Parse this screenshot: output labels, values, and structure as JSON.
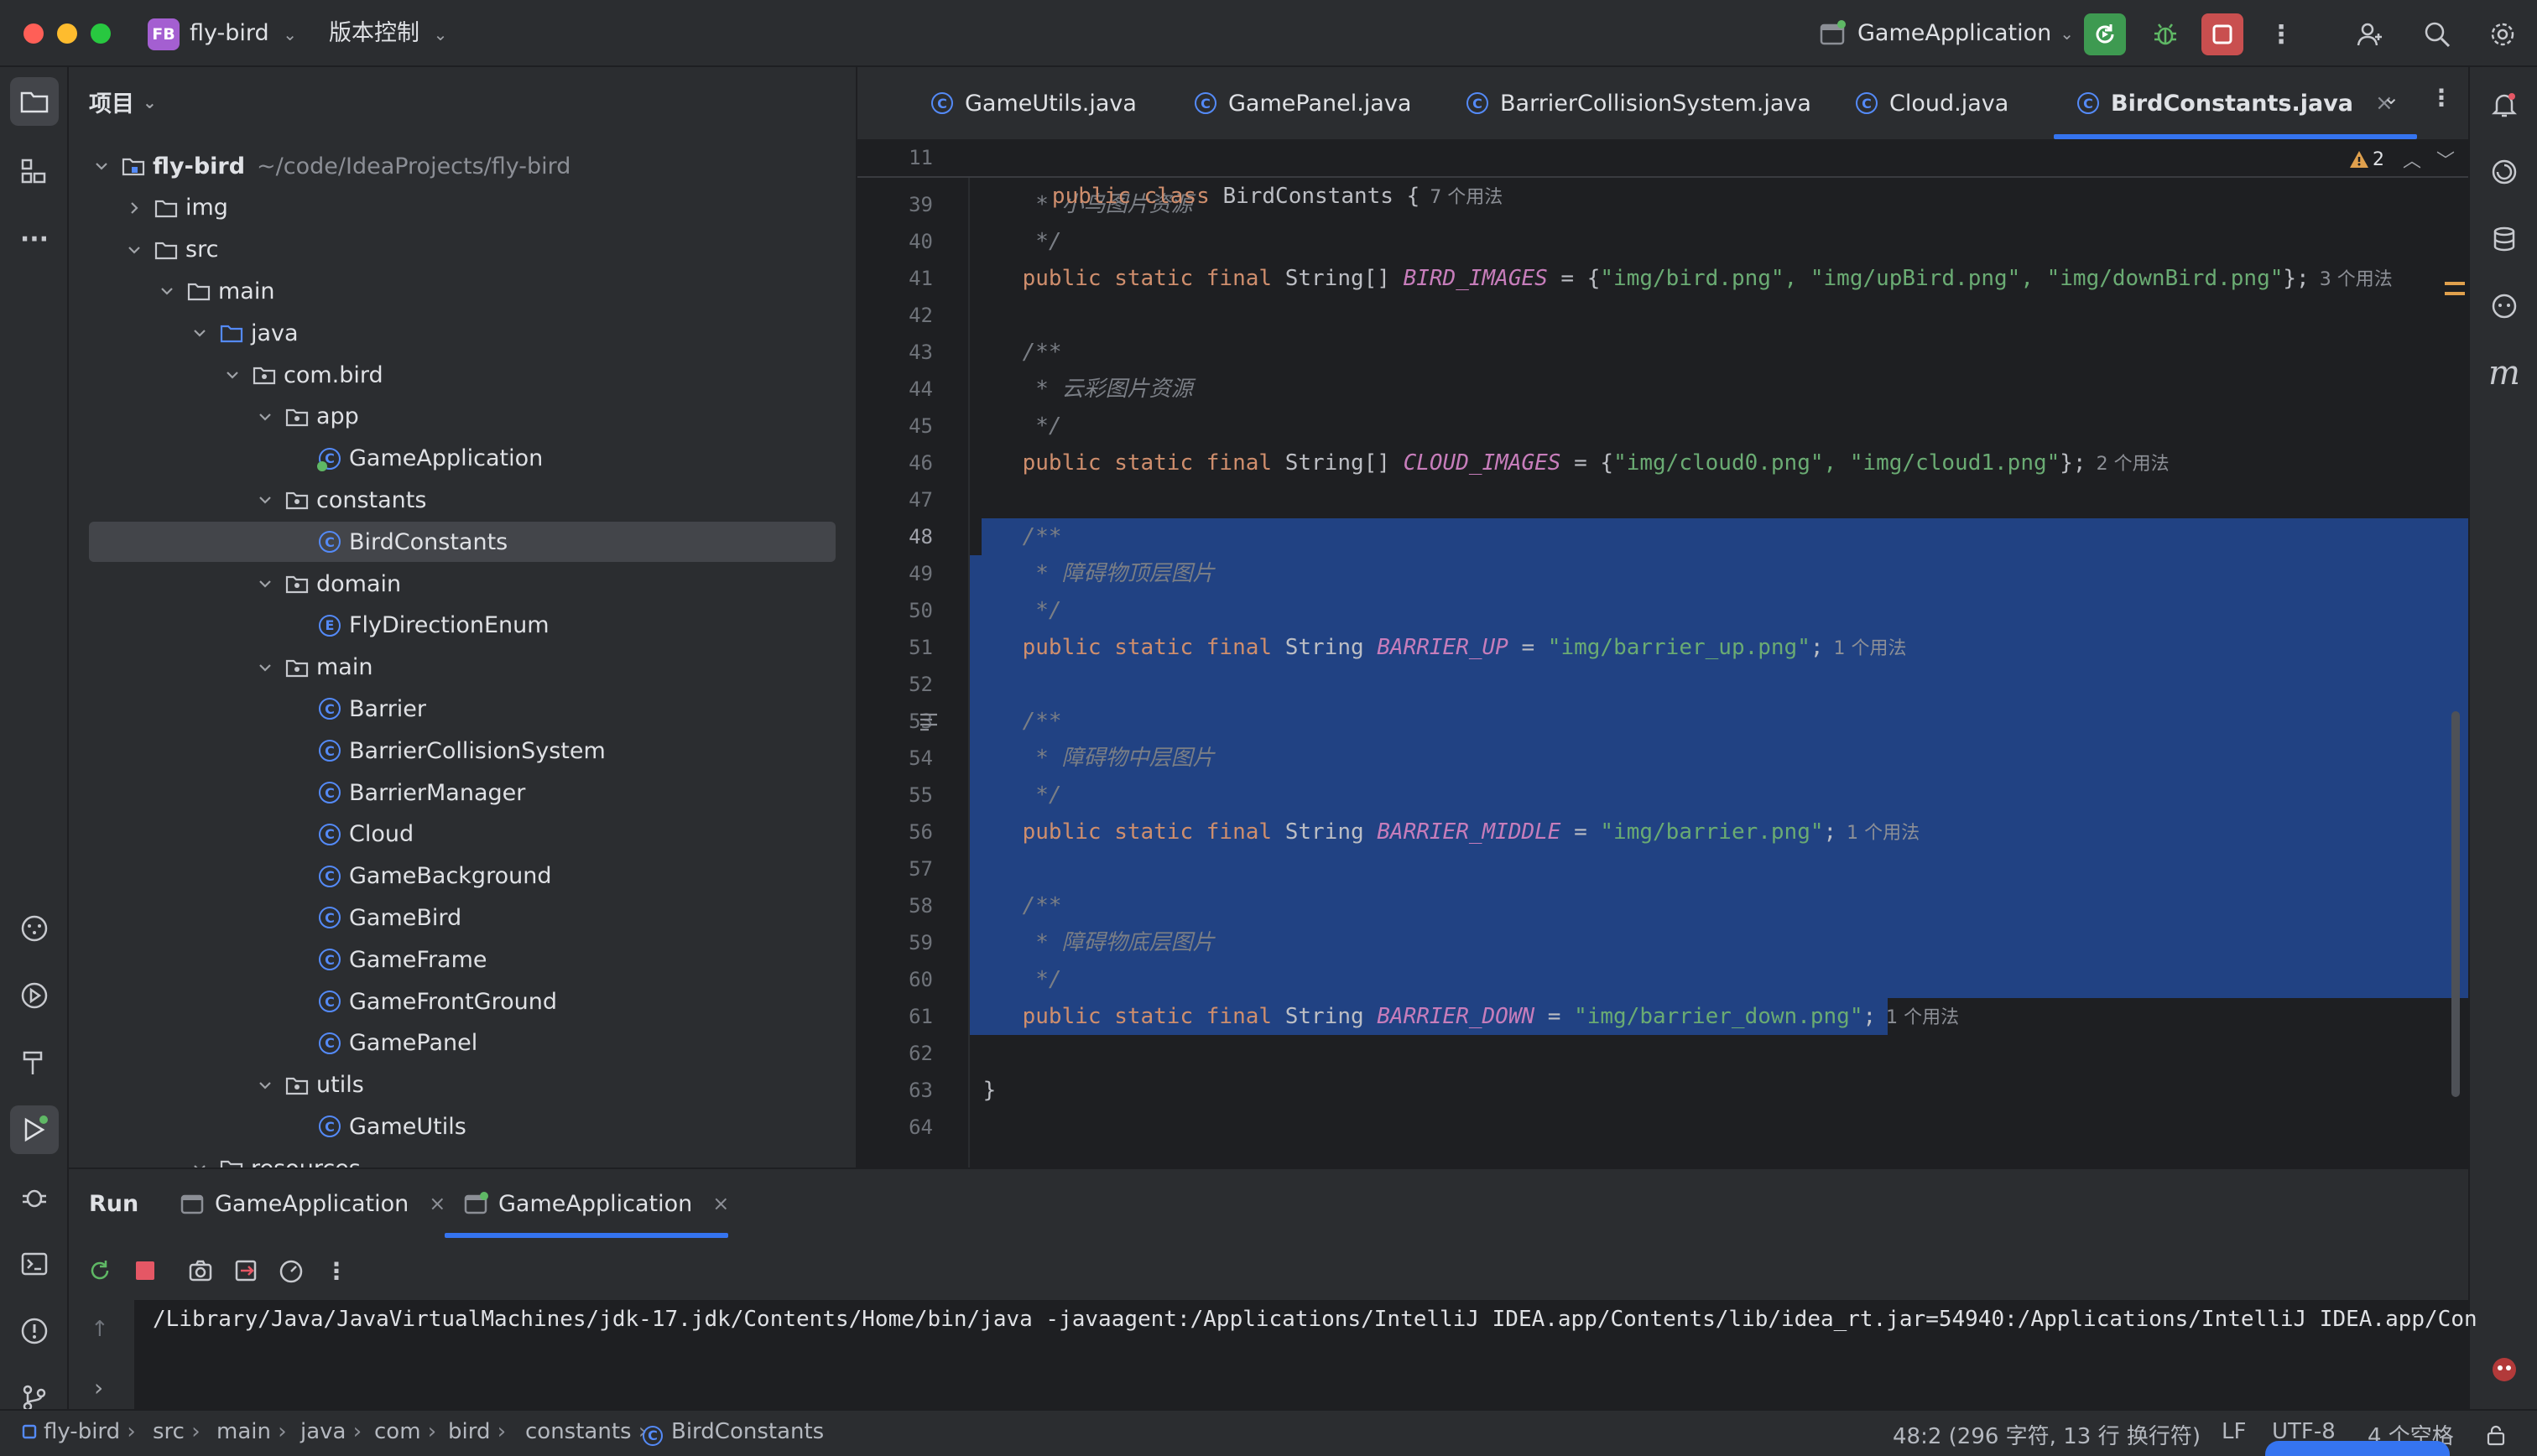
{
  "titlebar": {
    "project_badge": "FB",
    "project_name": "fly-bird",
    "vcs_label": "版本控制",
    "run_config": "GameApplication"
  },
  "project_panel": {
    "title": "项目",
    "tree": [
      {
        "label": "fly-bird",
        "path": "~/code/IdeaProjects/fly-bird"
      },
      {
        "label": "img"
      },
      {
        "label": "src"
      },
      {
        "label": "main"
      },
      {
        "label": "java"
      },
      {
        "label": "com.bird"
      },
      {
        "label": "app"
      },
      {
        "label": "GameApplication"
      },
      {
        "label": "constants"
      },
      {
        "label": "BirdConstants"
      },
      {
        "label": "domain"
      },
      {
        "label": "FlyDirectionEnum"
      },
      {
        "label": "main"
      },
      {
        "label": "Barrier"
      },
      {
        "label": "BarrierCollisionSystem"
      },
      {
        "label": "BarrierManager"
      },
      {
        "label": "Cloud"
      },
      {
        "label": "GameBackground"
      },
      {
        "label": "GameBird"
      },
      {
        "label": "GameFrame"
      },
      {
        "label": "GameFrontGround"
      },
      {
        "label": "GamePanel"
      },
      {
        "label": "utils"
      },
      {
        "label": "GameUtils"
      },
      {
        "label": "resources"
      }
    ]
  },
  "editor_tabs": [
    "GameUtils.java",
    "GamePanel.java",
    "BarrierCollisionSystem.java",
    "Cloud.java",
    "BirdConstants.java"
  ],
  "editor": {
    "sticky": {
      "line": "11",
      "kw1": "public",
      "kw2": "class",
      "name": "BirdConstants {",
      "hint": "7 个用法"
    },
    "warnings": "2",
    "lines": [
      {
        "n": "39",
        "c": " * 小鸟图片资源"
      },
      {
        "n": "40",
        "c": " */"
      },
      {
        "n": "41",
        "k": "public static final",
        "t": "String[]",
        "f": "BIRD_IMAGES",
        "eq": " = {",
        "s": "\"img/bird.png\", \"img/upBird.png\", \"img/downBird.png\"",
        "end": "};",
        "h": "3 个用法"
      },
      {
        "n": "42"
      },
      {
        "n": "43",
        "c": "/**"
      },
      {
        "n": "44",
        "c": " * 云彩图片资源"
      },
      {
        "n": "45",
        "c": " */"
      },
      {
        "n": "46",
        "k": "public static final",
        "t": "String[]",
        "f": "CLOUD_IMAGES",
        "eq": " = {",
        "s": "\"img/cloud0.png\", \"img/cloud1.png\"",
        "end": "};",
        "h": "2 个用法"
      },
      {
        "n": "47"
      },
      {
        "n": "48",
        "c": "/**"
      },
      {
        "n": "49",
        "c": " * 障碍物顶层图片"
      },
      {
        "n": "50",
        "c": " */"
      },
      {
        "n": "51",
        "k": "public static final",
        "t": "String",
        "f": "BARRIER_UP",
        "eq": " = ",
        "s": "\"img/barrier_up.png\"",
        "end": ";",
        "h": "1 个用法"
      },
      {
        "n": "52"
      },
      {
        "n": "53",
        "c": "/**"
      },
      {
        "n": "54",
        "c": " * 障碍物中层图片"
      },
      {
        "n": "55",
        "c": " */"
      },
      {
        "n": "56",
        "k": "public static final",
        "t": "String",
        "f": "BARRIER_MIDDLE",
        "eq": " = ",
        "s": "\"img/barrier.png\"",
        "end": ";",
        "h": "1 个用法"
      },
      {
        "n": "57"
      },
      {
        "n": "58",
        "c": "/**"
      },
      {
        "n": "59",
        "c": " * 障碍物底层图片"
      },
      {
        "n": "60",
        "c": " */"
      },
      {
        "n": "61",
        "k": "public static final",
        "t": "String",
        "f": "BARRIER_DOWN",
        "eq": " = ",
        "s": "\"img/barrier_down.png\"",
        "end": ";",
        "h": "1 个用法"
      },
      {
        "n": "62"
      },
      {
        "n": "63",
        "x": "}"
      },
      {
        "n": "64"
      }
    ]
  },
  "run_panel": {
    "title": "Run",
    "tabs": [
      "GameApplication",
      "GameApplication"
    ],
    "console_line": "/Library/Java/JavaVirtualMachines/jdk-17.jdk/Contents/Home/bin/java -javaagent:/Applications/IntelliJ IDEA.app/Contents/lib/idea_rt.jar=54940:/Applications/IntelliJ IDEA.app/Con"
  },
  "statusbar": {
    "breadcrumb": [
      "fly-bird",
      "src",
      "main",
      "java",
      "com",
      "bird",
      "constants",
      "BirdConstants"
    ],
    "position": "48:2 (296 字符, 13 行 换行符)",
    "line_sep": "LF",
    "encoding": "UTF-8",
    "indent": "4 个空格"
  }
}
